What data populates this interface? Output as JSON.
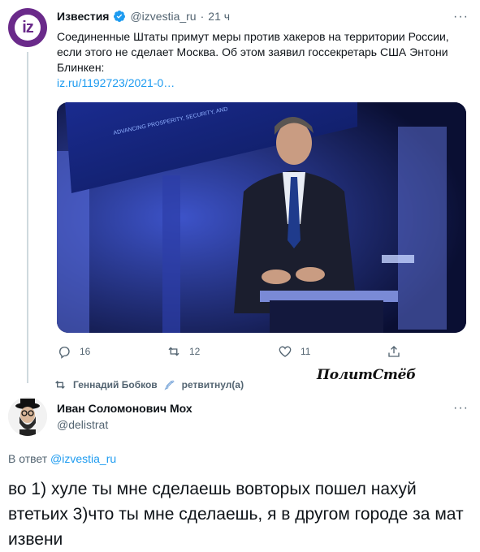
{
  "tweet": {
    "author_name": "Известия",
    "author_handle": "@izvestia_ru",
    "dot": "·",
    "time": "21 ч",
    "avatar_text": "iz",
    "text": "Соединенные Штаты примут меры против хакеров на территории России, если этого не сделает Москва. Об этом заявил госсекретарь США Энтони Блинкен:",
    "link": "iz.ru/1192723/2021-0…",
    "image_banner_text": "ADVANCING PROSPERITY, SECURITY, AND",
    "actions": {
      "reply_count": "16",
      "retweet_count": "12",
      "like_count": "11"
    },
    "more_label": "···"
  },
  "retweet_notice": {
    "user": "Геннадий Бобков",
    "suffix": "ретвитнул(а)"
  },
  "watermark": "ПолитСтёб",
  "reply_tweet": {
    "author_name": "Иван Соломонович Мох",
    "author_handle": "@delistrat",
    "more_label": "···",
    "reply_prefix": "В ответ",
    "reply_to": "@izvestia_ru",
    "text": "во 1) хуле ты мне сделаешь вовторых пошел нахуй втетьих 3)что ты мне сделаешь, я в другом городе за мат извени"
  },
  "colors": {
    "link": "#1d9bf0",
    "secondary_text": "#536471",
    "brand_purple": "#6a2a8a"
  }
}
